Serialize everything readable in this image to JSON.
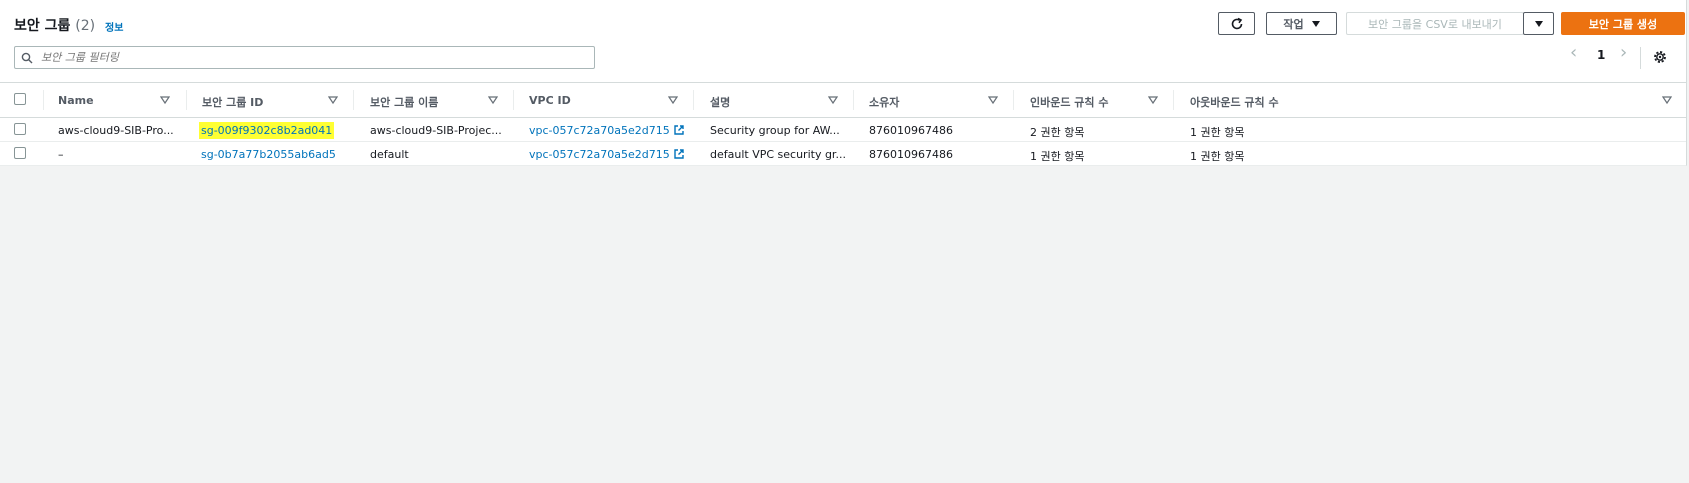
{
  "header": {
    "title": "보안 그룹",
    "count": "(2)",
    "info_link": "정보"
  },
  "toolbar": {
    "refresh_icon": "refresh-icon",
    "actions_label": "작업",
    "export_label": "보안 그룹을 CSV로 내보내기",
    "create_label": "보안 그룹 생성"
  },
  "search": {
    "placeholder": "보안 그룹 필터링"
  },
  "pagination": {
    "prev": "‹",
    "page": "1",
    "next": "›"
  },
  "table": {
    "columns": [
      "Name",
      "보안 그룹 ID",
      "보안 그룹 이름",
      "VPC ID",
      "설명",
      "소유자",
      "인바운드 규칙 수",
      "아웃바운드 규칙 수"
    ],
    "rows": [
      {
        "name": "aws-cloud9-SIB-Pro...",
        "group_id": "sg-009f9302c8b2ad041",
        "group_name": "aws-cloud9-SIB-Projec...",
        "vpc_id": "vpc-057c72a70a5e2d715",
        "description": "Security group for AW...",
        "owner": "876010967486",
        "inbound": "2 권한 항목",
        "outbound": "1 권한 항목"
      },
      {
        "name": "–",
        "group_id": "sg-0b7a77b2055ab6ad5",
        "group_name": "default",
        "vpc_id": "vpc-057c72a70a5e2d715",
        "description": "default VPC security gr...",
        "owner": "876010967486",
        "inbound": "1 권한 항목",
        "outbound": "1 권한 항목"
      }
    ]
  },
  "colors": {
    "accent": "#ec7211",
    "link": "#0073bb",
    "highlight": "#ffff33"
  }
}
